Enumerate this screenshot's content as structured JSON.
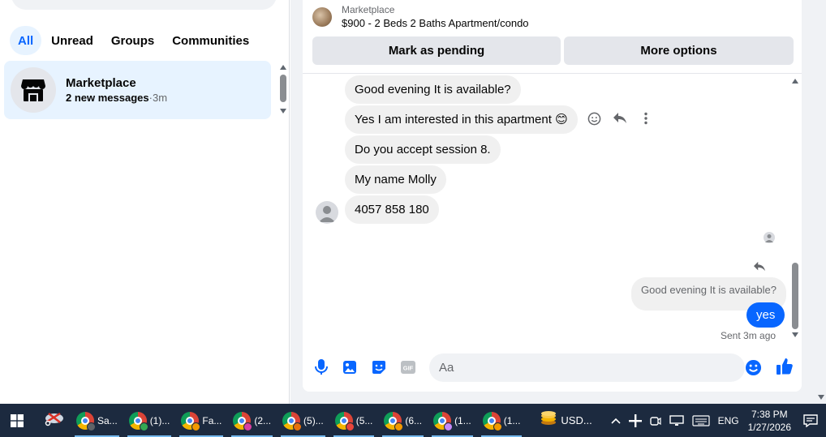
{
  "colors": {
    "accent": "#0866ff",
    "active_bg": "#e7f3ff",
    "bubble_in": "#f0f0f0",
    "taskbar": "#1c2a3f"
  },
  "left": {
    "tabs": [
      {
        "label": "All",
        "active": true
      },
      {
        "label": "Unread",
        "active": false
      },
      {
        "label": "Groups",
        "active": false
      },
      {
        "label": "Communities",
        "active": false
      }
    ],
    "chats": [
      {
        "name": "Marketplace",
        "preview": "2 new messages",
        "separator": "·",
        "time": "3m",
        "icon": "marketplace-store-icon",
        "selected": true
      }
    ]
  },
  "conversation": {
    "listing": {
      "source": "Marketplace",
      "title": "$900 - 2 Beds 2 Baths Apartment/condo"
    },
    "actions": {
      "mark_pending": "Mark as pending",
      "more_options": "More options"
    },
    "messages": [
      {
        "text": "Good evening It is available?",
        "direction": "incoming"
      },
      {
        "text": "Yes I am interested in this apartment",
        "emoji": "😊",
        "direction": "incoming"
      },
      {
        "text": "Do you accept session 8.",
        "direction": "incoming"
      },
      {
        "text": "My name Molly",
        "direction": "incoming"
      },
      {
        "text": "4057 858 180",
        "direction": "incoming"
      }
    ],
    "reply": {
      "quoted": "Good evening It is available?",
      "text": "yes",
      "status": "Sent 3m ago"
    },
    "message_tools": [
      "react-icon",
      "reply-icon",
      "more-icon"
    ],
    "composer": {
      "placeholder": "Aa",
      "icons": [
        "microphone-icon",
        "image-icon",
        "sticker-icon",
        "gif-icon",
        "emoji-icon",
        "thumbs-up-icon"
      ],
      "gif_label": "GIF"
    }
  },
  "taskbar": {
    "apps": [
      {
        "icon": "snipping-tool-icon",
        "label": ""
      },
      {
        "icon": "chrome-icon",
        "label": "Sa...",
        "badge": "C",
        "badge_color": "#5f6368"
      },
      {
        "icon": "chrome-icon",
        "label": "(1)...",
        "badge_color": "#34a853"
      },
      {
        "icon": "chrome-icon",
        "label": "Fa...",
        "badge_color": "#f29900"
      },
      {
        "icon": "chrome-icon",
        "label": "(2...",
        "badge_color": "#d93fa2"
      },
      {
        "icon": "chrome-icon",
        "label": "(5)...",
        "badge_color": "#e8710a"
      },
      {
        "icon": "chrome-icon",
        "label": "(5...",
        "badge_color": "#e8453c"
      },
      {
        "icon": "chrome-icon",
        "label": "(6...",
        "badge_color": "#f29900"
      },
      {
        "icon": "chrome-icon",
        "label": "(1...",
        "badge_color": "#c58af9"
      },
      {
        "icon": "chrome-icon",
        "label": "(1...",
        "badge_color": "#f29900"
      },
      {
        "icon": "stock-icon",
        "label": "USD..."
      }
    ],
    "tray": {
      "language": "ENG",
      "time": "7:38 PM",
      "date": "1/27/2026"
    }
  }
}
